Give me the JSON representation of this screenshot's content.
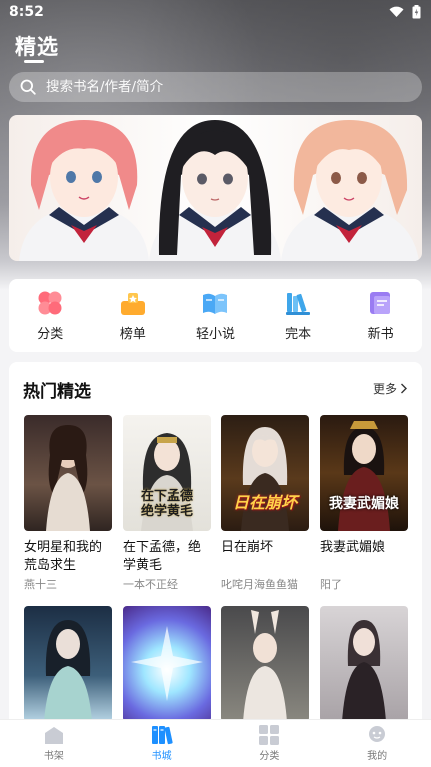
{
  "status": {
    "time": "8:52"
  },
  "header": {
    "title": "精选"
  },
  "search": {
    "placeholder": "搜索书名/作者/简介"
  },
  "categories": [
    {
      "label": "分类",
      "icon": "grid-icon",
      "color": "#ff6b7a"
    },
    {
      "label": "榜单",
      "icon": "trophy-icon",
      "color": "#ffab2e"
    },
    {
      "label": "轻小说",
      "icon": "open-book-icon",
      "color": "#4aa8f5"
    },
    {
      "label": "完本",
      "icon": "books-icon",
      "color": "#3fa6ea"
    },
    {
      "label": "新书",
      "icon": "new-book-icon",
      "color": "#9a7cf2"
    }
  ],
  "section": {
    "title": "热门精选",
    "more_label": "更多",
    "books": [
      {
        "title": "女明星和我的荒岛求生",
        "author": "燕十三"
      },
      {
        "title": "在下孟德，绝学黄毛",
        "author": "一本不正经"
      },
      {
        "title": "日在崩坏",
        "author": "叱咤月海鱼鱼猫"
      },
      {
        "title": "我妻武媚娘",
        "author": "阳了"
      },
      {
        "title": "",
        "author": ""
      },
      {
        "title": "",
        "author": ""
      },
      {
        "title": "",
        "author": ""
      },
      {
        "title": "",
        "author": ""
      }
    ],
    "cover_texts": {
      "b2": "在下孟德\n绝学黄毛",
      "b3": "日在崩坏",
      "b4": "我妻武媚娘"
    }
  },
  "tabbar": [
    {
      "label": "书架",
      "active": false
    },
    {
      "label": "书城",
      "active": true
    },
    {
      "label": "分类",
      "active": false
    },
    {
      "label": "我的",
      "active": false
    }
  ],
  "colors": {
    "accent": "#1e90ff"
  }
}
